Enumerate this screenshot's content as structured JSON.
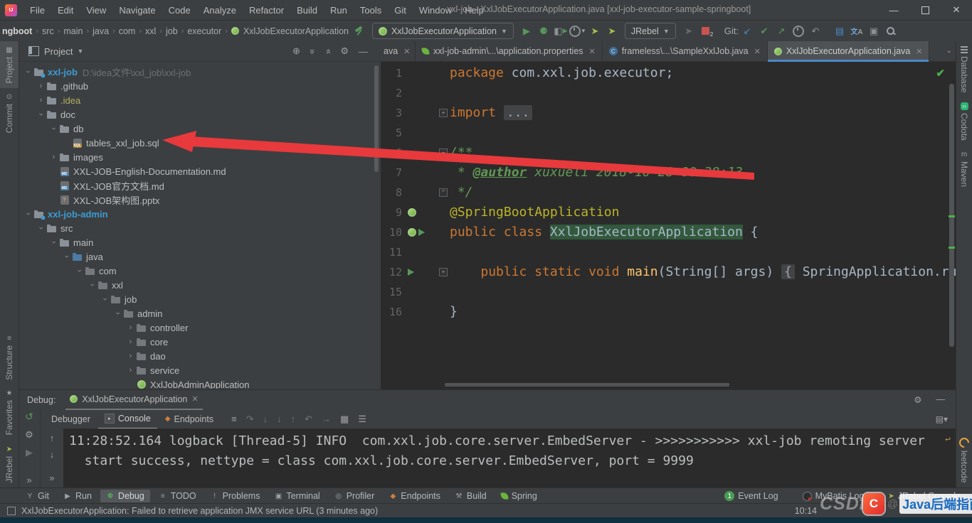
{
  "window": {
    "logo": "IJ",
    "title": "xxl-job - XxlJobExecutorApplication.java [xxl-job-executor-sample-springboot]",
    "menus": [
      "File",
      "Edit",
      "View",
      "Navigate",
      "Code",
      "Analyze",
      "Refactor",
      "Build",
      "Run",
      "Tools",
      "Git",
      "Window",
      "Help"
    ]
  },
  "toolbar": {
    "breadcrumbs": [
      "ngboot",
      "src",
      "main",
      "java",
      "com",
      "xxl",
      "job",
      "executor",
      "XxlJobExecutorApplication"
    ],
    "run_config": "XxlJobExecutorApplication",
    "jrebel_label": "JRebel",
    "git_label": "Git:"
  },
  "left_stripe": {
    "top": [
      {
        "label": "Project",
        "icon": "project-tool-icon",
        "active": true
      },
      {
        "label": "Commit",
        "icon": "commit-tool-icon"
      }
    ],
    "bottom": [
      {
        "label": "Structure",
        "icon": "structure-tool-icon"
      },
      {
        "label": "Favorites",
        "icon": "star-icon"
      },
      {
        "label": "JRebel",
        "icon": "jrebel-icon"
      }
    ]
  },
  "right_stripe": {
    "top": [
      {
        "label": "Database",
        "icon": "database-icon"
      },
      {
        "label": "Codota",
        "icon": "codota-icon"
      },
      {
        "label": "Maven",
        "icon": "maven-icon"
      }
    ],
    "bottom": [
      {
        "label": "leetcode",
        "icon": "leetcode-icon"
      }
    ]
  },
  "project_panel": {
    "title": "Project",
    "tree": [
      {
        "level": 0,
        "chevron": "open",
        "icon": "module",
        "label": "xxl-job",
        "color": "module",
        "suffix": "D:\\idea文件\\xxl_job\\xxl-job"
      },
      {
        "level": 1,
        "chevron": "closed",
        "icon": "folder",
        "label": ".github"
      },
      {
        "level": 1,
        "chevron": "closed",
        "icon": "folder",
        "label": ".idea",
        "color": "excluded"
      },
      {
        "level": 1,
        "chevron": "open",
        "icon": "folder",
        "label": "doc"
      },
      {
        "level": 2,
        "chevron": "open",
        "icon": "folder",
        "label": "db"
      },
      {
        "level": 3,
        "chevron": "none",
        "icon": "sql",
        "label": "tables_xxl_job.sql"
      },
      {
        "level": 2,
        "chevron": "closed",
        "icon": "folder",
        "label": "images"
      },
      {
        "level": 2,
        "chevron": "none",
        "icon": "md",
        "label": "XXL-JOB-English-Documentation.md"
      },
      {
        "level": 2,
        "chevron": "none",
        "icon": "md",
        "label": "XXL-JOB官方文档.md"
      },
      {
        "level": 2,
        "chevron": "none",
        "icon": "pptx",
        "label": "XXL-JOB架构图.pptx"
      },
      {
        "level": 0,
        "chevron": "open",
        "icon": "module",
        "label": "xxl-job-admin",
        "color": "module"
      },
      {
        "level": 1,
        "chevron": "open",
        "icon": "folder",
        "label": "src"
      },
      {
        "level": 2,
        "chevron": "open",
        "icon": "folder",
        "label": "main"
      },
      {
        "level": 3,
        "chevron": "open",
        "icon": "srcfolder",
        "label": "java"
      },
      {
        "level": 4,
        "chevron": "open",
        "icon": "package",
        "label": "com"
      },
      {
        "level": 5,
        "chevron": "open",
        "icon": "package",
        "label": "xxl"
      },
      {
        "level": 6,
        "chevron": "open",
        "icon": "package",
        "label": "job"
      },
      {
        "level": 7,
        "chevron": "open",
        "icon": "package",
        "label": "admin"
      },
      {
        "level": 8,
        "chevron": "closed",
        "icon": "package",
        "label": "controller"
      },
      {
        "level": 8,
        "chevron": "closed",
        "icon": "package",
        "label": "core"
      },
      {
        "level": 8,
        "chevron": "closed",
        "icon": "package",
        "label": "dao"
      },
      {
        "level": 8,
        "chevron": "closed",
        "icon": "package",
        "label": "service"
      },
      {
        "level": 8,
        "chevron": "none",
        "icon": "springboot",
        "label": "XxlJobAdminApplication"
      }
    ]
  },
  "editor": {
    "tabs": [
      {
        "label": "ava",
        "icon": "none",
        "partial": true
      },
      {
        "label": "xxl-job-admin\\...\\application.properties",
        "icon": "spring-leaf"
      },
      {
        "label": "frameless\\...\\SampleXxlJob.java",
        "icon": "class"
      },
      {
        "label": "XxlJobExecutorApplication.java",
        "icon": "springboot",
        "active": true
      }
    ],
    "code": [
      {
        "n": "1",
        "tokens": [
          [
            "kw",
            "package "
          ],
          [
            "pl",
            "com.xxl.job.executor;"
          ]
        ]
      },
      {
        "n": "2",
        "tokens": []
      },
      {
        "n": "3",
        "fold": "plus",
        "tokens": [
          [
            "kw",
            "import "
          ],
          [
            "fold",
            "..."
          ]
        ]
      },
      {
        "n": "5",
        "tokens": []
      },
      {
        "n": "6",
        "fold": "minus",
        "tokens": [
          [
            "cm",
            "/**"
          ]
        ]
      },
      {
        "n": "7",
        "tokens": [
          [
            "cm",
            " * "
          ],
          [
            "tag",
            "@author"
          ],
          [
            "cm",
            " xuxueli 2018-10-28 00:38:13"
          ]
        ]
      },
      {
        "n": "8",
        "fold": "end",
        "tokens": [
          [
            "cm",
            " */"
          ]
        ]
      },
      {
        "n": "9",
        "gutter": "spring",
        "tokens": [
          [
            "an",
            "@SpringBootApplication"
          ]
        ]
      },
      {
        "n": "10",
        "gutter": "springrun",
        "tokens": [
          [
            "kw",
            "public class "
          ],
          [
            "hl",
            "XxlJobExecutorApplication"
          ],
          [
            "pl",
            " {"
          ]
        ]
      },
      {
        "n": "11",
        "tokens": []
      },
      {
        "n": "12",
        "gutter": "run",
        "fold": "plus",
        "tokens": [
          [
            "pl",
            "    "
          ],
          [
            "kw",
            "public static void "
          ],
          [
            "mt",
            "main"
          ],
          [
            "pl",
            "(String[] args) "
          ],
          [
            "fold",
            "{"
          ],
          [
            "pl",
            " SpringApplication.ru"
          ]
        ]
      },
      {
        "n": "15",
        "tokens": []
      },
      {
        "n": "16",
        "tokens": [
          [
            "pl",
            "}"
          ]
        ]
      }
    ]
  },
  "debug": {
    "label": "Debug:",
    "session_tab": "XxlJobExecutorApplication",
    "tabs": [
      {
        "label": "Debugger"
      },
      {
        "label": "Console",
        "icon": "console-icon",
        "active": true
      },
      {
        "label": "Endpoints",
        "icon": "endpoints-icon"
      }
    ],
    "console": [
      "11:28:52.164 logback [Thread-5] INFO  com.xxl.job.core.server.EmbedServer - >>>>>>>>>>> xxl-job remoting server",
      "  start success, nettype = class com.xxl.job.core.server.EmbedServer, port = 9999"
    ]
  },
  "bottom_bar": {
    "left": [
      {
        "label": "Git",
        "icon": "git-branch-icon"
      },
      {
        "label": "Run",
        "icon": "run-icon"
      },
      {
        "label": "Debug",
        "icon": "debug-bug-icon",
        "active": true
      },
      {
        "label": "TODO",
        "icon": "todo-icon"
      },
      {
        "label": "Problems",
        "icon": "problems-icon"
      },
      {
        "label": "Terminal",
        "icon": "terminal-icon"
      },
      {
        "label": "Profiler",
        "icon": "profiler-icon"
      },
      {
        "label": "Endpoints",
        "icon": "endpoints-icon"
      },
      {
        "label": "Build",
        "icon": "build-hammer-icon"
      },
      {
        "label": "Spring",
        "icon": "spring-leaf-icon"
      }
    ],
    "right": [
      {
        "label": "Event Log",
        "badge": "1"
      },
      {
        "label": "MyBatis Log",
        "icon": "mybatis-icon"
      },
      {
        "label": "JRebel Console",
        "icon": "jrebel-icon"
      }
    ]
  },
  "status_bar": {
    "message": "XxlJobExecutorApplication: Failed to retrieve application JMX service URL (3 minutes ago)",
    "time": "10:14"
  },
  "watermark": {
    "brand": "CSDN",
    "sep": "@",
    "name": "Java后端指南"
  },
  "colors": {
    "accent_blue": "#4A88C7",
    "run_green": "#57965C",
    "spring_green": "#6DB33F",
    "error_red": "#C75450",
    "arrow_red": "#E8393C",
    "keyword_orange": "#CC7832",
    "comment_green": "#629755",
    "annotation_yellow": "#BBB529"
  }
}
